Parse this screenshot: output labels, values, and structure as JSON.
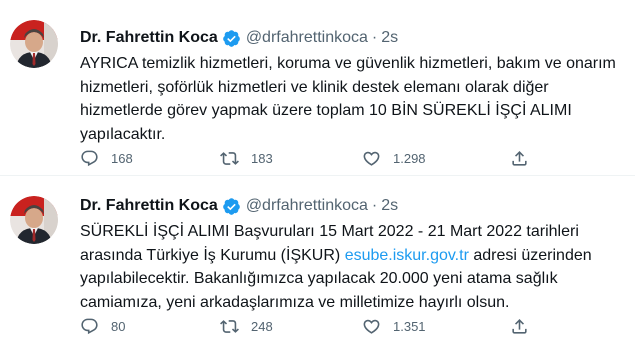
{
  "colors": {
    "text": "#0f1419",
    "secondary": "#536471",
    "link": "#1d9bf0",
    "verified": "#1d9bf0",
    "divider": "#eff3f4"
  },
  "tweets": [
    {
      "author_name": "Dr. Fahrettin Koca",
      "handle": "@drfahrettinkoca",
      "separator": "·",
      "time": "2s",
      "text": "AYRICA temizlik hizmetleri, koruma ve güvenlik hizmetleri, bakım ve onarım\nhizmetleri, şoförlük hizmetleri ve klinik destek elemanı olarak diğer\nhizmetlerde görev yapmak üzere toplam 10 BİN SÜREKLİ İŞÇİ ALIMI\nyapılacaktır.",
      "replies": "168",
      "retweets": "183",
      "likes": "1.298",
      "avatar_icon": "profile-photo",
      "verified_icon": "verified-badge-icon"
    },
    {
      "author_name": "Dr. Fahrettin Koca",
      "handle": "@drfahrettinkoca",
      "separator": "·",
      "time": "2s",
      "text_before_link": "SÜREKLİ İŞÇİ ALIMI Başvuruları 15 Mart 2022 - 21 Mart 2022 tarihleri\narasında Türkiye İş Kurumu (İŞKUR) ",
      "link_text": "esube.iskur.gov.tr",
      "text_after_link": " adresi üzerinden\nyapılabilecektir. Bakanlığımızca yapılacak 20.000 yeni atama sağlık\ncamiamıza, yeni arkadaşlarımıza ve milletimize hayırlı olsun.",
      "replies": "80",
      "retweets": "248",
      "likes": "1.351",
      "avatar_icon": "profile-photo",
      "verified_icon": "verified-badge-icon"
    }
  ]
}
